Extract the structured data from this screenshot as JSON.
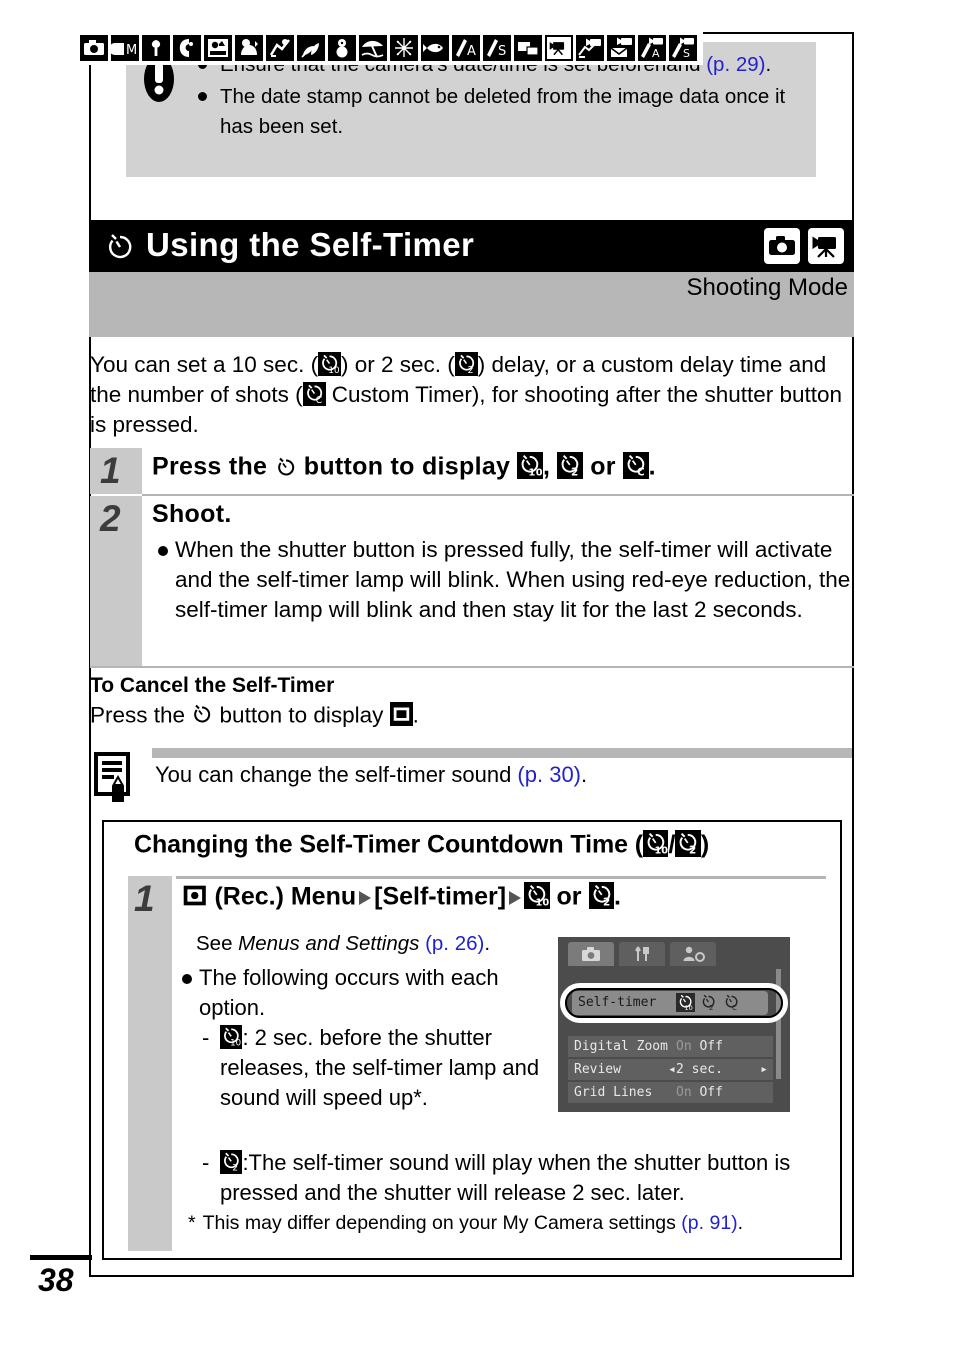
{
  "page_number": "38",
  "caution": {
    "icon": "exclamation-icon",
    "items": [
      {
        "text_before": "Ensure that the camera’s date/time is set beforehand ",
        "link": "(p. 29)",
        "text_after": "."
      },
      {
        "text_before": "The date stamp cannot be deleted from the image data once it has been set.",
        "link": "",
        "text_after": ""
      }
    ]
  },
  "section": {
    "title": "Using the Self-Timer",
    "timer_icon": "self-timer-icon",
    "mode_badges": [
      "still-camera-icon",
      "movie-camera-icon"
    ],
    "shooting_mode_label": "Shooting Mode",
    "mode_icons": [
      "auto-mode-icon",
      "manual-mode-icon",
      "digital-macro-icon",
      "portrait-icon",
      "night-snapshot-icon",
      "kids-and-pets-icon",
      "indoor-icon",
      "foliage-icon",
      "snow-icon",
      "beach-icon",
      "fireworks-icon",
      "underwater-icon",
      "aperture-priority-icon",
      "shutter-priority-icon",
      "stitch-assist-icon",
      "movie-standard-icon",
      "movie-fast-frame-icon",
      "movie-compact-icon",
      "movie-color-accent-icon",
      "movie-color-swap-icon"
    ]
  },
  "intro": {
    "p1": "You can set a 10 sec. (",
    "p2": ") or 2 sec. (",
    "p3": ") delay, or a custom delay time and the number of shots (",
    "p4": " Custom Timer), for shooting after the shutter button is pressed."
  },
  "steps": [
    {
      "number": "1",
      "title_a": "Press the ",
      "title_b": " button to display ",
      "title_c": ", ",
      "title_d": " or ",
      "title_e": "."
    },
    {
      "number": "2",
      "title": "Shoot.",
      "bullets": [
        "When the shutter button is pressed fully, the self-timer will activate and the self-timer lamp will blink. When using red-eye reduction, the self-timer lamp will blink and then stay lit for the last 2 seconds."
      ]
    }
  ],
  "cancel": {
    "heading": "To Cancel the Self-Timer",
    "text_a": "Press the ",
    "text_b": " button to display ",
    "text_c": "."
  },
  "note": {
    "icon": "memo-note-icon",
    "text_before": "You can change the self-timer sound ",
    "link": "(p. 30)",
    "text_after": "."
  },
  "subsection": {
    "title_a": "Changing the Self-Timer Countdown Time (",
    "title_sep": "/",
    "title_b": ")",
    "step_number": "1",
    "step_a": " (Rec.) Menu",
    "step_b": "[Self-timer]",
    "step_c": " or ",
    "step_d": ".",
    "see_before": "See ",
    "see_italic": "Menus and Settings ",
    "see_link": "(p. 26)",
    "see_after": ".",
    "bullet_intro": "The following occurs with each option.",
    "option1_text": ": 2 sec. before the shutter releases, the self-timer lamp and sound will speed up*.",
    "option2_text": ":The self-timer sound will play when the shutter button is pressed and the shutter will release 2 sec. later.",
    "footnote_star": "*",
    "footnote_before": "This may differ depending on your My Camera settings ",
    "footnote_link": "(p. 91)",
    "footnote_after": "."
  },
  "lcd": {
    "tabs": [
      "rec-tab-icon",
      "setup-tab-icon",
      "my-camera-tab-icon"
    ],
    "selected_row": {
      "label": "Self-timer",
      "options": [
        "timer-10sec-icon",
        "timer-2sec-icon",
        "timer-custom-icon"
      ],
      "selected_index": 0
    },
    "rows": [
      {
        "label": "Digital Zoom",
        "value_on": "On",
        "value_off": "Off",
        "selected": "Off",
        "type": "toggle"
      },
      {
        "label": "Review",
        "value": "2 sec.",
        "type": "stepper"
      },
      {
        "label": "Grid Lines",
        "value_on": "On",
        "value_off": "Off",
        "selected": "Off",
        "type": "toggle"
      }
    ]
  },
  "colors": {
    "link": "#2222cc",
    "caution_bg": "#d2d2d2",
    "band_bg": "#b7b7b7",
    "step_col_bg": "#c9c9c9",
    "title_bg": "#000000",
    "lcd_bg": "#4c4c4c"
  }
}
